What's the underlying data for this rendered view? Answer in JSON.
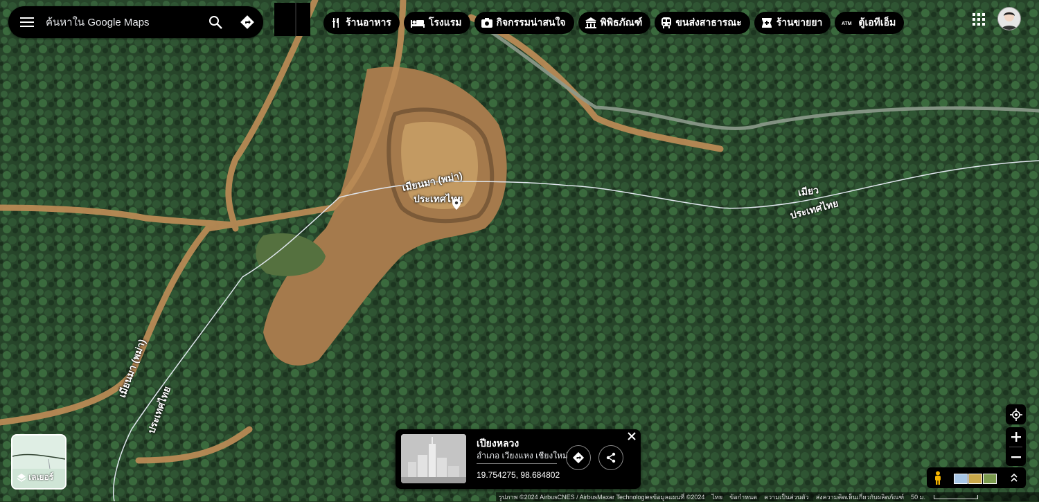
{
  "search": {
    "placeholder": "ค้นหาใน Google Maps"
  },
  "chips": [
    {
      "label": "ร้านอาหาร",
      "icon": "restaurant-icon"
    },
    {
      "label": "โรงแรม",
      "icon": "hotel-icon"
    },
    {
      "label": "กิจกรรมน่าสนใจ",
      "icon": "camera-icon"
    },
    {
      "label": "พิพิธภัณฑ์",
      "icon": "museum-icon"
    },
    {
      "label": "ขนส่งสาธารณะ",
      "icon": "transit-icon"
    },
    {
      "label": "ร้านขายยา",
      "icon": "pharmacy-icon"
    },
    {
      "label": "ตู้เอทีเอ็ม",
      "icon": "atm-icon"
    }
  ],
  "map_labels": {
    "border_a_line1": "เมียนมา (พม่า)",
    "border_a_line2": "ประเทศไทย",
    "border_b_line1": "เมียนมา (พม่า)",
    "border_b_line2": "ประเทศไทย",
    "border_c_line1": "เมียว",
    "border_c_line2": "ประเทศไทย"
  },
  "layers": {
    "label": "เลเยอร์"
  },
  "place_card": {
    "title": "เปียงหลวง",
    "subtitle": "อำเภอ เวียงแหง เชียงใหม่",
    "coordinates": "19.754275, 98.684802"
  },
  "footer": {
    "imagery": "รูปภาพ ©2024 AirbusCNES / AirbusMaxar Technologiesข้อมูลแผนที่ ©2024",
    "language": "ไทย",
    "terms": "ข้อกำหนด",
    "privacy": "ความเป็นส่วนตัว",
    "feedback": "ส่งความคิดเห็นเกี่ยวกับผลิตภัณฑ์",
    "scale": "50 ม."
  },
  "colors": {
    "forest": "#2b4a2a",
    "dirt": "#b88a55",
    "border_line": "#e0e6ee"
  }
}
